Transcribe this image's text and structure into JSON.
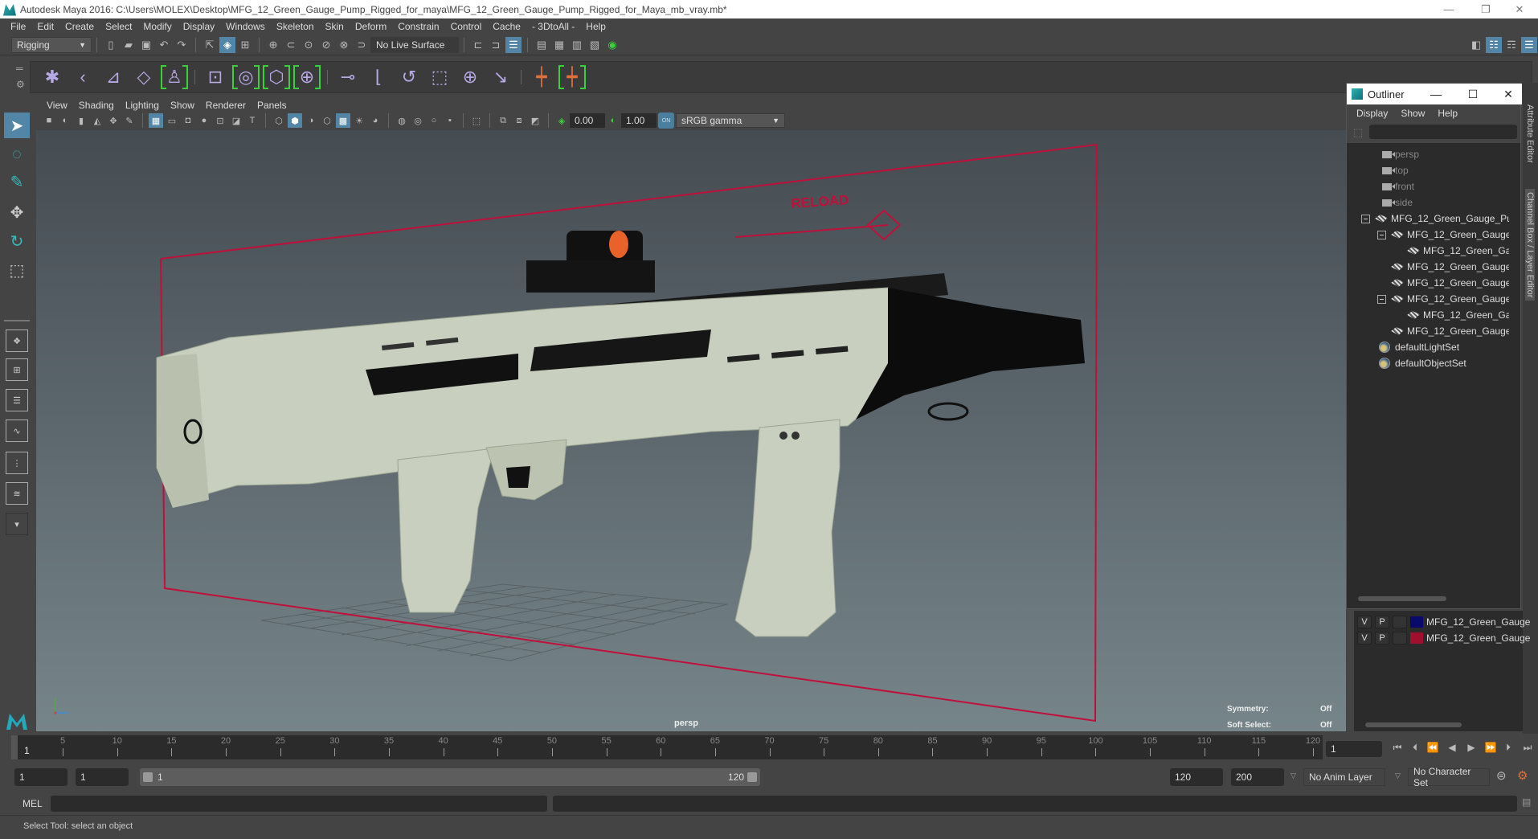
{
  "window": {
    "title": "Autodesk Maya 2016: C:\\Users\\MOLEX\\Desktop\\MFG_12_Green_Gauge_Pump_Rigged_for_maya\\MFG_12_Green_Gauge_Pump_Rigged_for_Maya_mb_vray.mb*",
    "minimize": "—",
    "restore": "❐",
    "close": "✕"
  },
  "menubar": [
    "File",
    "Edit",
    "Create",
    "Select",
    "Modify",
    "Display",
    "Windows",
    "Skeleton",
    "Skin",
    "Deform",
    "Constrain",
    "Control",
    "Cache",
    "- 3DtoAll -",
    "Help"
  ],
  "status_line": {
    "menu_set": "Rigging",
    "live_surface": "No Live Surface"
  },
  "viewport": {
    "menu": [
      "View",
      "Shading",
      "Lighting",
      "Show",
      "Renderer",
      "Panels"
    ],
    "exposure": "0.00",
    "gamma": "1.00",
    "color_mgmt_toggle": "ON",
    "color_space": "sRGB gamma",
    "camera_label": "persp",
    "hud": {
      "symmetry_label": "Symmetry:",
      "symmetry_value": "Off",
      "soft_select_label": "Soft Select:",
      "soft_select_value": "Off"
    },
    "rig_annotation": "RELOAD",
    "colors": {
      "rig_curve": "#c0103a",
      "stock_color": "#c8cfbf"
    }
  },
  "outliner": {
    "title": "Outliner",
    "menu": [
      "Display",
      "Show",
      "Help"
    ],
    "items": [
      {
        "label": "persp",
        "type": "camera"
      },
      {
        "label": "top",
        "type": "camera"
      },
      {
        "label": "front",
        "type": "camera"
      },
      {
        "label": "side",
        "type": "camera"
      },
      {
        "label": "MFG_12_Green_Gauge_Pur",
        "type": "mesh"
      },
      {
        "label": "MFG_12_Green_Gauge_",
        "type": "mesh"
      },
      {
        "label": "MFG_12_Green_Ga",
        "type": "mesh"
      },
      {
        "label": "MFG_12_Green_Gauge_",
        "type": "mesh"
      },
      {
        "label": "MFG_12_Green_Gauge_",
        "type": "mesh"
      },
      {
        "label": "MFG_12_Green_Gauge_",
        "type": "mesh"
      },
      {
        "label": "MFG_12_Green_Ga",
        "type": "mesh"
      },
      {
        "label": "MFG_12_Green_Gauge_",
        "type": "mesh"
      },
      {
        "label": "defaultLightSet",
        "type": "set"
      },
      {
        "label": "defaultObjectSet",
        "type": "set"
      }
    ]
  },
  "side_tabs": {
    "attribute_editor": "Attribute Editor",
    "channel_box": "Channel Box / Layer Editor"
  },
  "layers": [
    {
      "v": "V",
      "p": "P",
      "color": "#0a0a6a",
      "name": "MFG_12_Green_Gauge"
    },
    {
      "v": "V",
      "p": "P",
      "color": "#a0102e",
      "name": "MFG_12_Green_Gauge"
    }
  ],
  "timeline": {
    "ticks": [
      "5",
      "10",
      "15",
      "20",
      "25",
      "30",
      "35",
      "40",
      "45",
      "50",
      "55",
      "60",
      "65",
      "70",
      "75",
      "80",
      "85",
      "90",
      "95",
      "100",
      "105",
      "110",
      "115",
      "120"
    ],
    "current_frame_marker": "1",
    "current_frame": "1"
  },
  "range": {
    "start": "1",
    "playback_start": "1",
    "slider_start": "1",
    "slider_end": "120",
    "playback_end": "120",
    "end": "200",
    "anim_layer": "No Anim Layer",
    "character_set": "No Character Set"
  },
  "command_line": {
    "label": "MEL",
    "value": ""
  },
  "help_line": "Select Tool: select an object"
}
